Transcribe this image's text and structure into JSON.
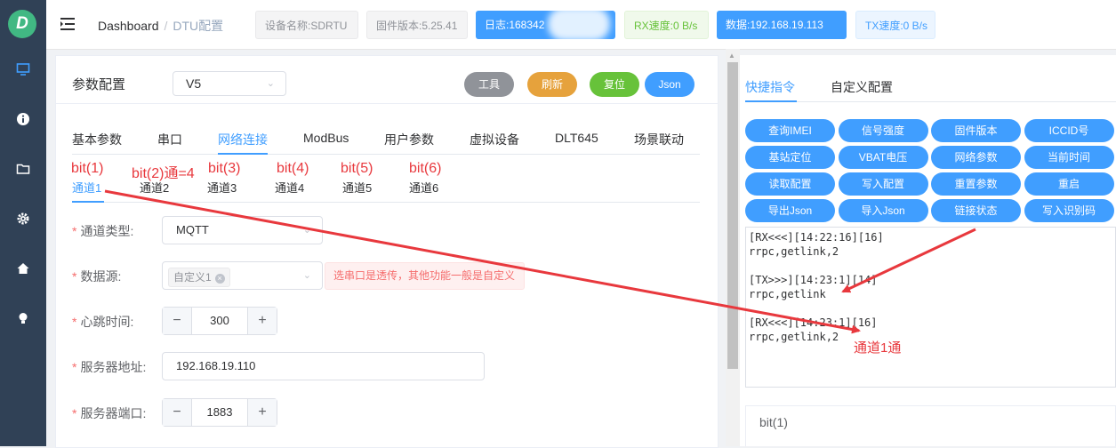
{
  "sidebar": {
    "logo": "D",
    "icons": [
      "monitor-icon",
      "info-icon",
      "folder-icon",
      "gear-icon",
      "home-icon",
      "bulb-icon"
    ]
  },
  "header": {
    "breadcrumb": [
      "Dashboard",
      "DTU配置"
    ],
    "device_name": "设备名称:SDRTU",
    "firmware": "固件版本:5.25.41",
    "log": "日志:168342",
    "rx_speed": "RX速度:0 B/s",
    "data_ip": "数据:192.168.19.113",
    "tx_speed": "TX速度:0 B/s"
  },
  "config": {
    "title": "参数配置",
    "version": "V5",
    "buttons": {
      "tools": "工具",
      "refresh": "刷新",
      "reset": "复位",
      "json": "Json"
    },
    "tabs": [
      "基本参数",
      "串口",
      "网络连接",
      "ModBus",
      "用户参数",
      "虚拟设备",
      "DLT645",
      "场景联动"
    ],
    "channels": [
      "通道1",
      "通道2",
      "通道3",
      "通道4",
      "通道5",
      "通道6"
    ],
    "channel_bits": [
      "bit(1)",
      "bit(2)通=4",
      "bit(3)",
      "bit(4)",
      "bit(5)",
      "bit(6)"
    ],
    "fields": {
      "channel_type_label": "通道类型:",
      "channel_type_value": "MQTT",
      "data_source_label": "数据源:",
      "data_source_chip": "自定义1",
      "data_source_hint": "选串口是透传，其他功能一般是自定义",
      "heartbeat_label": "心跳时间:",
      "heartbeat_value": "300",
      "server_addr_label": "服务器地址:",
      "server_addr_value": "192.168.19.110",
      "server_port_label": "服务器端口:",
      "server_port_value": "1883"
    }
  },
  "right": {
    "tabs": [
      "快捷指令",
      "自定义配置"
    ],
    "quick_buttons": [
      "查询IMEI",
      "信号强度",
      "固件版本",
      "ICCID号",
      "基站定位",
      "VBAT电压",
      "网络参数",
      "当前时间",
      "读取配置",
      "写入配置",
      "重置参数",
      "重启",
      "导出Json",
      "导入Json",
      "链接状态",
      "写入识别码"
    ],
    "log_lines": [
      "[RX<<<][14:22:16][16]",
      "rrpc,getlink,2",
      "",
      "[TX>>>][14:23:1][14]",
      "rrpc,getlink",
      "",
      "[RX<<<][14:23:1][16]",
      "rrpc,getlink,2"
    ],
    "annotation": "通道1通",
    "bit_label": "bit(1)"
  },
  "colors": {
    "primary": "#409eff",
    "annotation_red": "#e8383d",
    "sidebar": "#304156"
  }
}
